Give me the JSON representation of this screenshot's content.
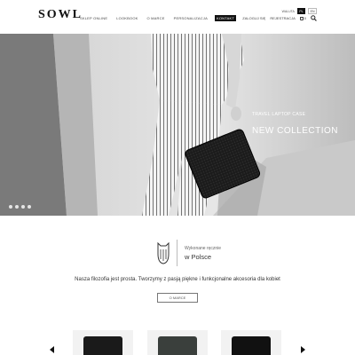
{
  "header": {
    "logo": "SOWL",
    "nav": [
      "SKLEP ONLINE",
      "LOOKBOOK",
      "O MARCE",
      "PERSONALIZACJA",
      "KONTAKT"
    ],
    "active_nav": "KONTAKT",
    "currency_label": "WALUTA",
    "languages": [
      "PL",
      "EN"
    ],
    "selected_language": "PL",
    "login_label": "ZALOGUJ SIĘ",
    "register_label": "REJESTRACJA",
    "cart_count": "0",
    "icons": [
      "bag-icon",
      "search-icon"
    ]
  },
  "hero": {
    "subtitle": "TRAVEL LAPTOP CASE",
    "title": "NEW COLLECTION",
    "slides_count": 4,
    "active_slide": 1
  },
  "made_in": {
    "small": "Wykonane ręcznie",
    "big": "w Polsce"
  },
  "philosophy": "Nasza filozofia jest prosta. Tworzymy z pasją piękne i funkcjonalne akcesoria dla kobiet",
  "about_button": "O MARCE",
  "products": [
    {
      "color": "#1a1a1a"
    },
    {
      "color": "#3a3f3c"
    },
    {
      "color": "#111111"
    }
  ]
}
